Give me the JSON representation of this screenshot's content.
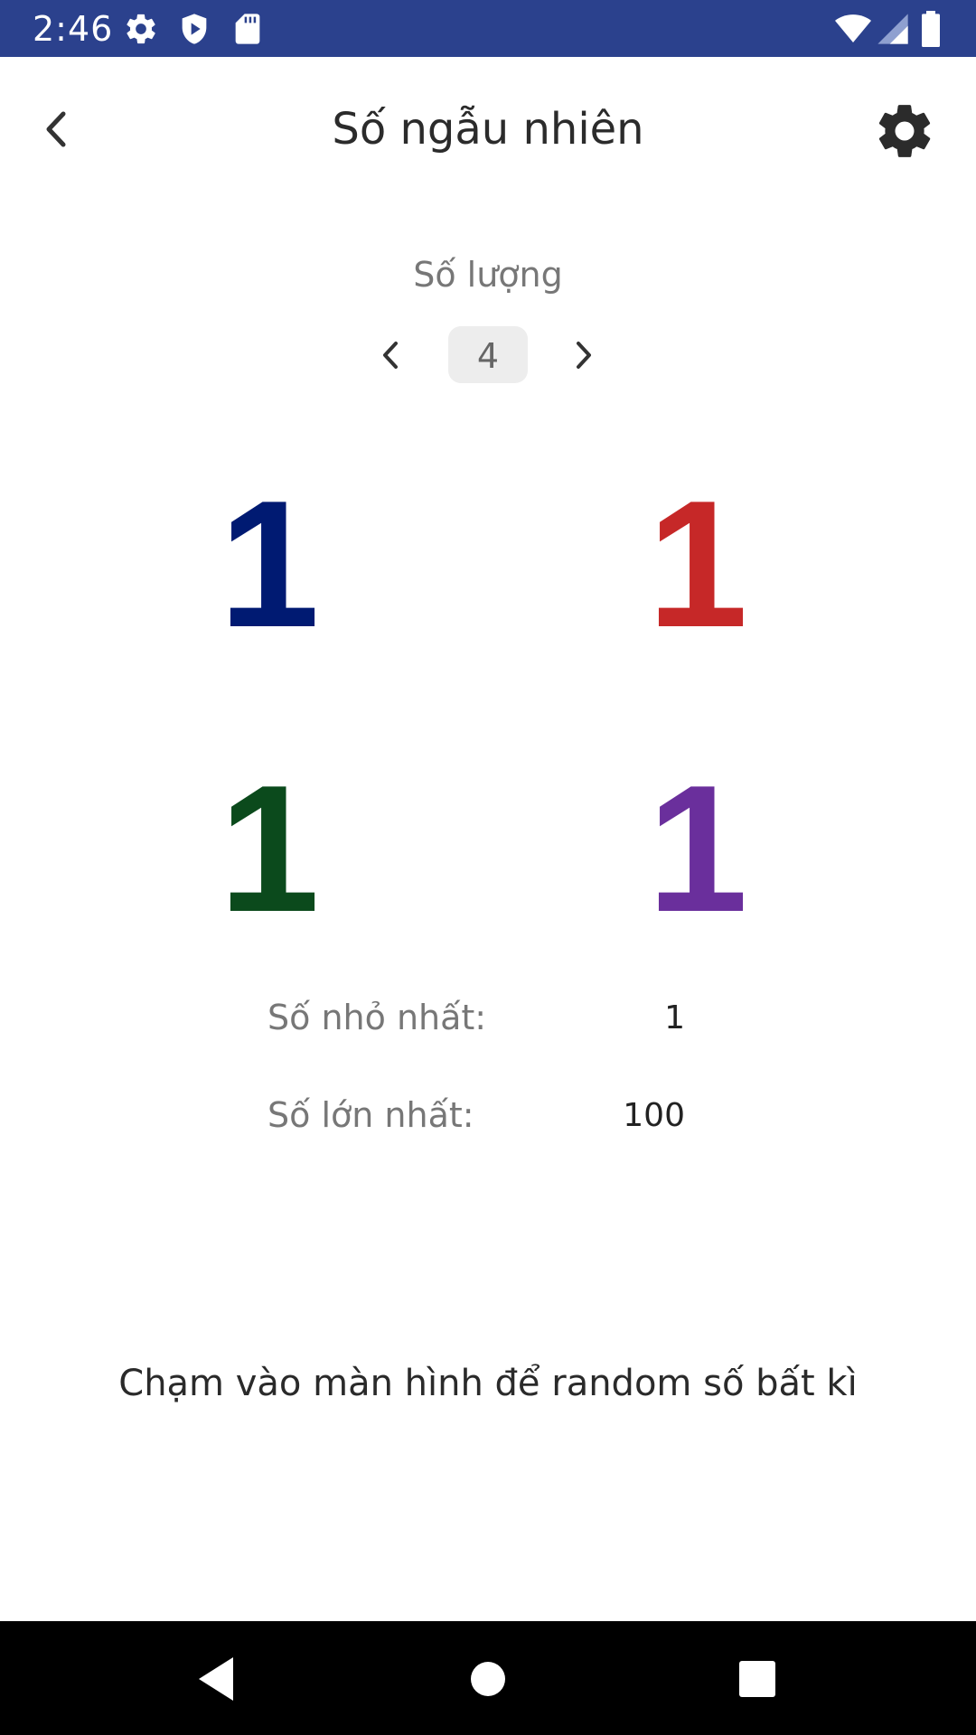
{
  "status_bar": {
    "time": "2:46",
    "background": "#2b418d",
    "icons": [
      "gear-icon",
      "shield-play-icon",
      "sd-card-icon",
      "wifi-icon",
      "signal-icon",
      "battery-icon"
    ]
  },
  "app_bar": {
    "title": "Số ngẫu nhiên",
    "back_icon": "chevron-left-icon",
    "settings_icon": "gear-icon"
  },
  "quantity": {
    "label": "Số lượng",
    "value": "4"
  },
  "numbers": [
    {
      "value": "1",
      "color": "#001a72"
    },
    {
      "value": "1",
      "color": "#c62828"
    },
    {
      "value": "1",
      "color": "#0b4a1c"
    },
    {
      "value": "1",
      "color": "#6a2f9c"
    }
  ],
  "range": {
    "min_label": "Số nhỏ nhất:",
    "min_value": "1",
    "max_label": "Số lớn nhất:",
    "max_value": "100"
  },
  "hint": "Chạm vào màn hình để random số bất kì",
  "nav_bar": {
    "icons": [
      "back-triangle-icon",
      "home-circle-icon",
      "recents-square-icon"
    ]
  }
}
